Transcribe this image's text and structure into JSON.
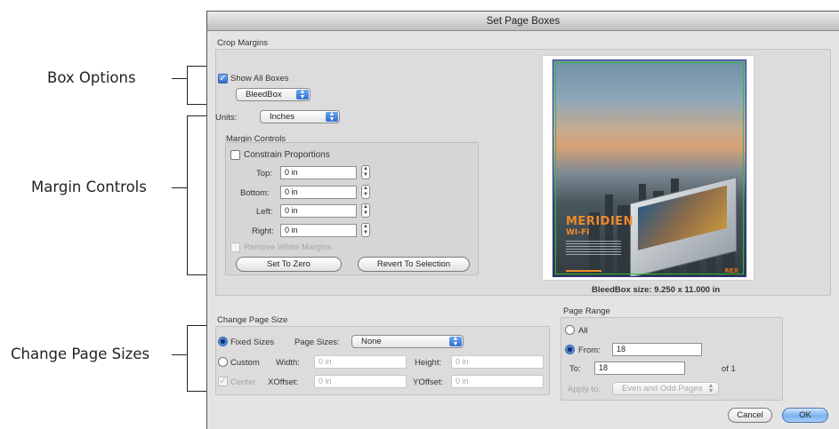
{
  "callouts": {
    "box_options": "Box Options",
    "margin_controls": "Margin Controls",
    "change_page_sizes": "Change Page Sizes"
  },
  "dialog": {
    "title": "Set Page Boxes",
    "crop_margins": {
      "heading": "Crop Margins",
      "show_all_boxes": {
        "label": "Show All Boxes",
        "checked": true
      },
      "box_select": "BleedBox",
      "units_label": "Units:",
      "units_value": "Inches",
      "margin_controls": {
        "heading": "Margin Controls",
        "constrain_proportions": {
          "label": "Constrain Proportions",
          "checked": false
        },
        "top_label": "Top:",
        "top_value": "0 in",
        "bottom_label": "Bottom:",
        "bottom_value": "0 in",
        "left_label": "Left:",
        "left_value": "0 in",
        "right_label": "Right:",
        "right_value": "0 in",
        "remove_white_margins": "Remove White Margins",
        "set_to_zero": "Set To Zero",
        "revert_to_selection": "Revert To Selection"
      },
      "preview": {
        "headline": "MERIDIEN",
        "subhead": "WI-FI",
        "logo": "REX"
      },
      "box_size": "BleedBox size: 9.250 x 11.000 in"
    },
    "change_page_size": {
      "heading": "Change Page Size",
      "fixed_sizes": "Fixed Sizes",
      "page_sizes_label": "Page Sizes:",
      "page_sizes_value": "None",
      "custom": "Custom",
      "width_label": "Width:",
      "width_value": "0 in",
      "height_label": "Height:",
      "height_value": "0 in",
      "center": "Center",
      "xoffset_label": "XOffset:",
      "xoffset_value": "0 in",
      "yoffset_label": "YOffset:",
      "yoffset_value": "0 in"
    },
    "page_range": {
      "heading": "Page Range",
      "all": "All",
      "from_label": "From:",
      "from_value": "18",
      "to_label": "To:",
      "to_value": "18",
      "of_total": "of 1",
      "apply_to_label": "Apply to:",
      "apply_to_value": "Even and Odd Pages"
    },
    "cancel_button": "Cancel",
    "ok_button": "OK"
  },
  "colors": {
    "dialog_bg": "#e4e4e4",
    "accent_blue": "#3e7ce0",
    "bleed_green": "#2dbd3a",
    "brand_orange": "#f08a2c"
  }
}
